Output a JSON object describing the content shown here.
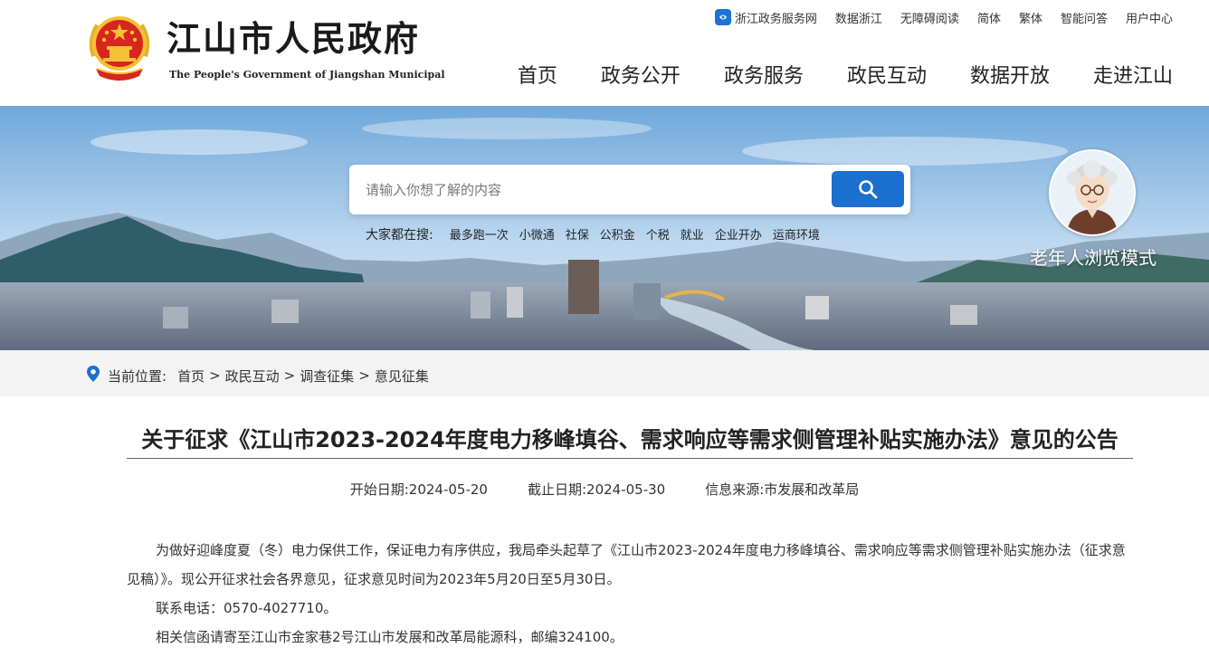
{
  "header": {
    "title": "江山市人民政府",
    "subtitle": "The People's Government of Jiangshan Municipal",
    "top_links": [
      {
        "label": "浙江政务服务网",
        "icon": "zhejiang-gov-icon"
      },
      {
        "label": "数据浙江"
      },
      {
        "label": "无障碍阅读"
      },
      {
        "label": "简体"
      },
      {
        "label": "繁体"
      },
      {
        "label": "智能问答"
      },
      {
        "label": "用户中心"
      }
    ],
    "nav": [
      "首页",
      "政务公开",
      "政务服务",
      "政民互动",
      "数据开放",
      "走进江山"
    ]
  },
  "banner": {
    "search_placeholder": "请输入你想了解的内容",
    "search_icon": "search-icon",
    "hot_label": "大家都在搜:",
    "hot_items": [
      "最多跑一次",
      "小微通",
      "社保",
      "公积金",
      "个税",
      "就业",
      "企业开办",
      "运商环境"
    ],
    "elder_mode_label": "老年人浏览模式"
  },
  "breadcrumb": {
    "label": "当前位置:",
    "items": [
      "首页",
      "政民互动",
      "调查征集",
      "意见征集"
    ],
    "separator": ">"
  },
  "article": {
    "title": "关于征求《江山市2023-2024年度电力移峰填谷、需求响应等需求侧管理补贴实施办法》意见的公告",
    "start_date": "开始日期:2024-05-20",
    "end_date": "截止日期:2024-05-30",
    "source": "信息来源:市发展和改革局",
    "paragraphs": [
      "为做好迎峰度夏（冬）电力保供工作，保证电力有序供应，我局牵头起草了《江山市2023-2024年度电力移峰填谷、需求响应等需求侧管理补贴实施办法（征求意见稿）》。现公开征求社会各界意见，征求意见时间为2023年5月20日至5月30日。",
      "联系电话：0570-4027710。",
      "相关信函请寄至江山市金家巷2号江山市发展和改革局能源科，邮编324100。"
    ]
  },
  "colors": {
    "accent_blue": "#1a6fcf",
    "emblem_red": "#d7261e",
    "emblem_gold": "#f4c234",
    "breadcrumb_bg": "#f3f3f3"
  }
}
